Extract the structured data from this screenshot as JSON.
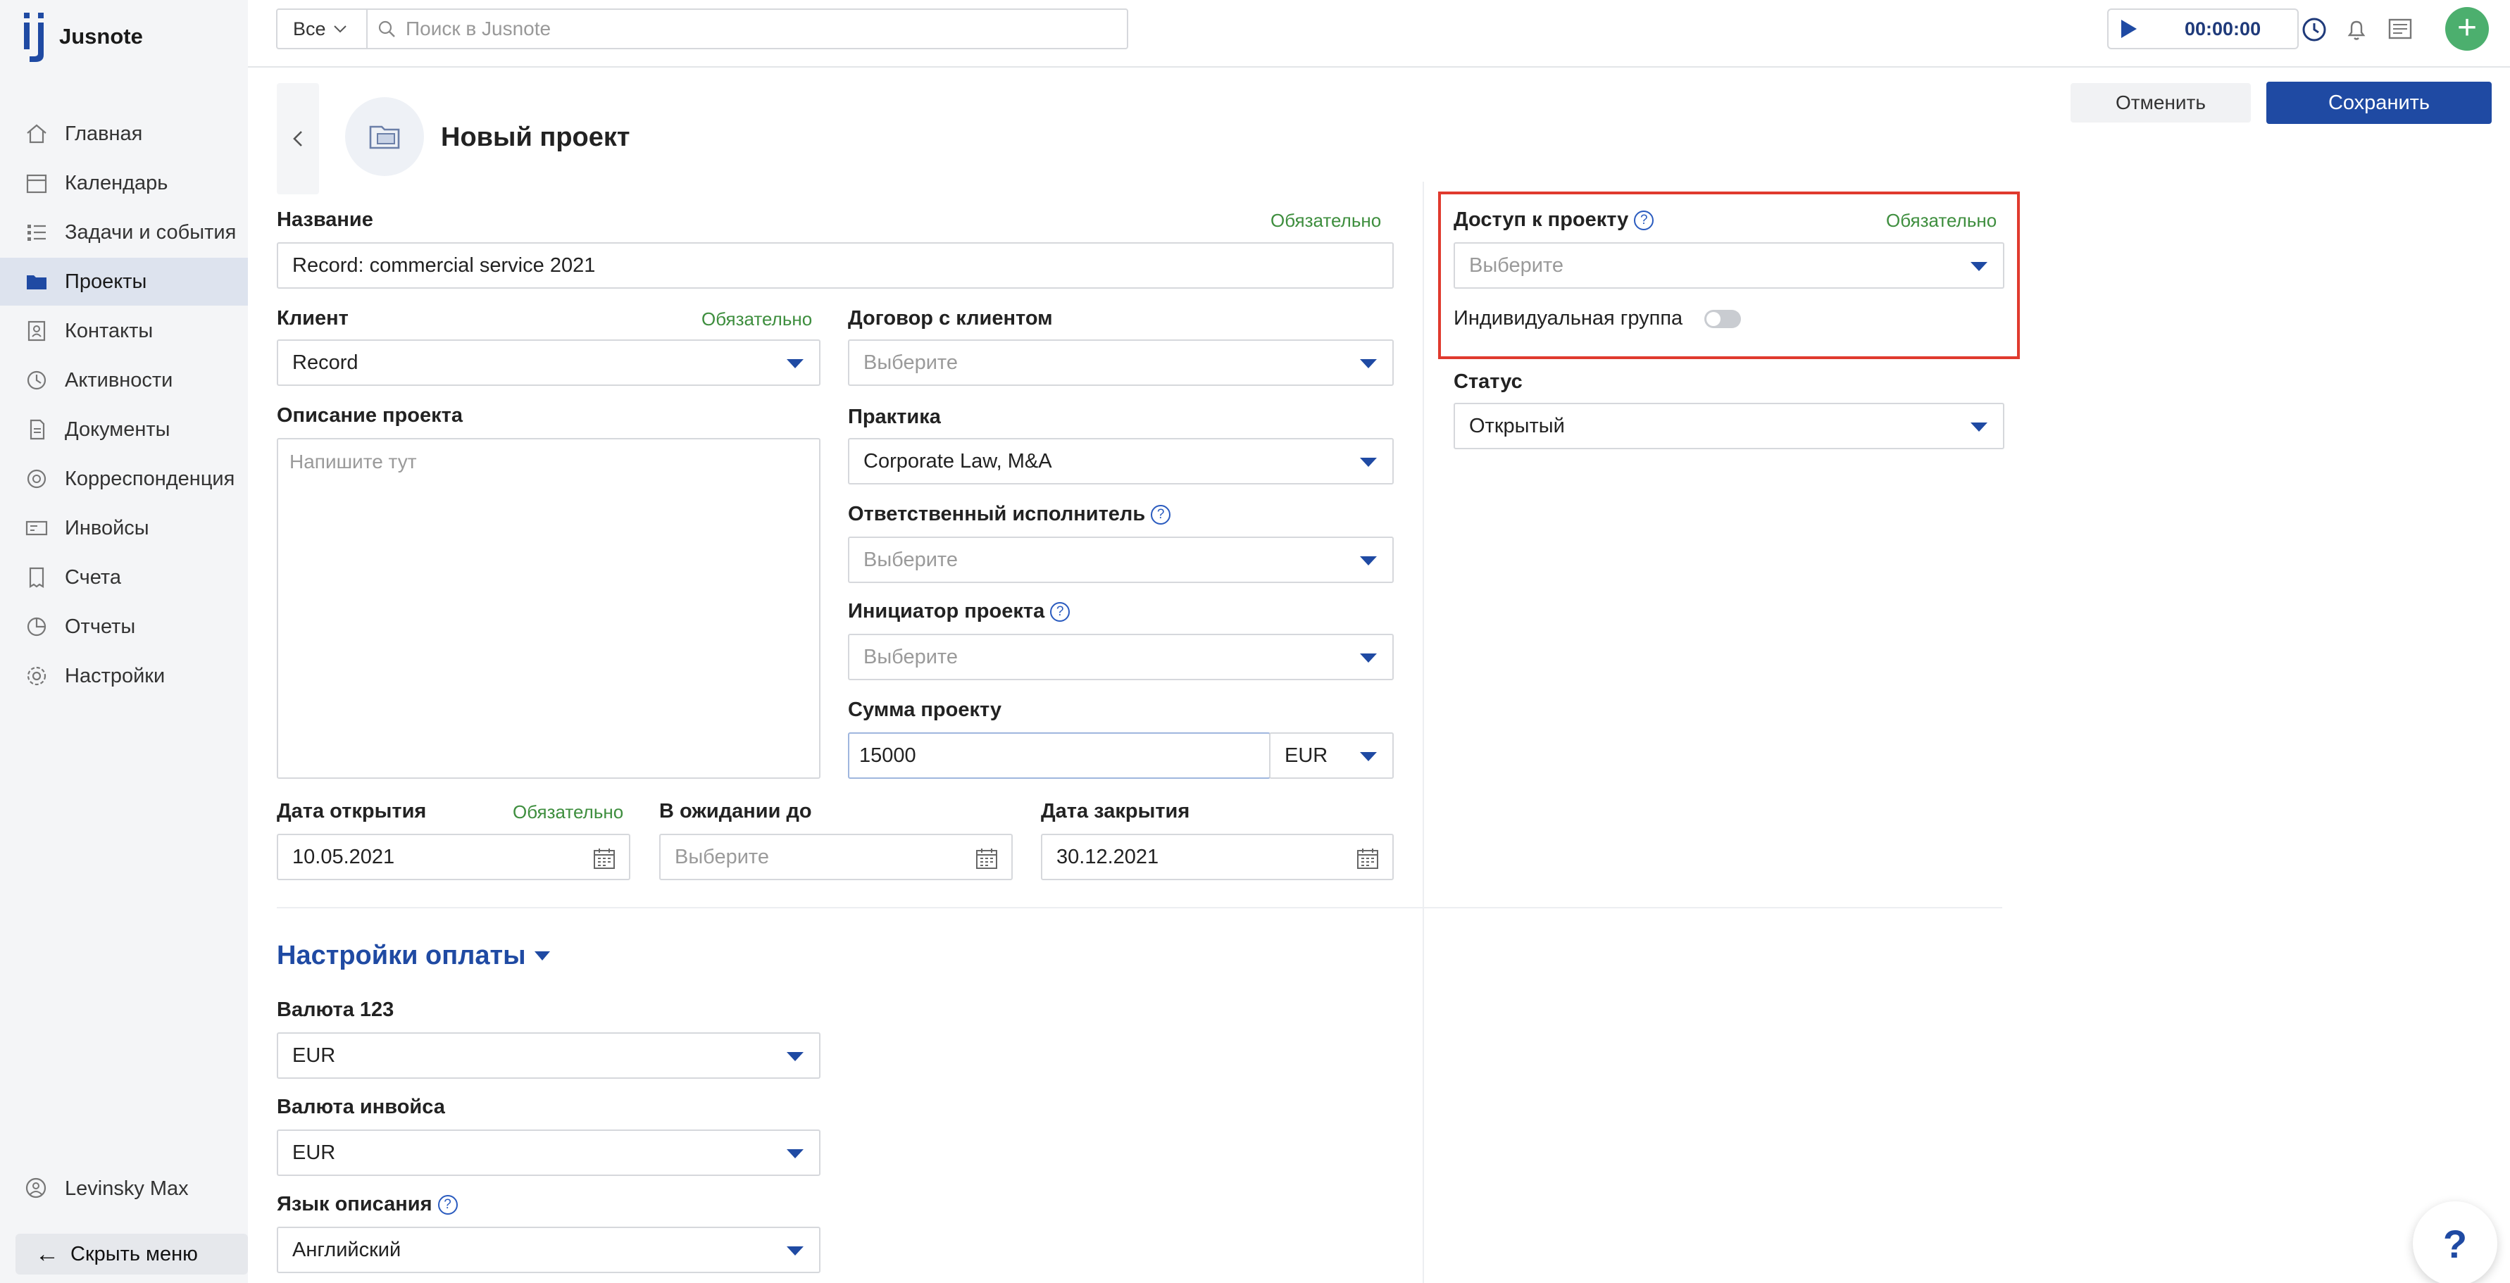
{
  "app": {
    "name": "Jusnote",
    "brand_color": "#1f4aa3"
  },
  "sidebar": {
    "items": [
      {
        "label": "Главная",
        "icon": "home-icon"
      },
      {
        "label": "Календарь",
        "icon": "calendar-icon"
      },
      {
        "label": "Задачи и события",
        "icon": "tasks-icon"
      },
      {
        "label": "Проекты",
        "icon": "folder-icon",
        "active": true
      },
      {
        "label": "Контакты",
        "icon": "contacts-icon"
      },
      {
        "label": "Активности",
        "icon": "activity-icon"
      },
      {
        "label": "Документы",
        "icon": "documents-icon"
      },
      {
        "label": "Корреспонденция",
        "icon": "mail-icon"
      },
      {
        "label": "Инвойсы",
        "icon": "invoice-icon"
      },
      {
        "label": "Счета",
        "icon": "bill-icon"
      },
      {
        "label": "Отчеты",
        "icon": "report-icon"
      },
      {
        "label": "Настройки",
        "icon": "gear-icon"
      }
    ],
    "user": "Levinsky Max",
    "hide_menu": "Скрыть меню"
  },
  "topbar": {
    "search_scope": "Все",
    "search_placeholder": "Поиск в Jusnote",
    "timer": "00:00:00"
  },
  "header": {
    "title": "Новый проект",
    "cancel": "Отменить",
    "save": "Сохранить"
  },
  "required_text": "Обязательно",
  "form": {
    "name_label": "Название",
    "name_value": "Record: commercial service 2021",
    "client_label": "Клиент",
    "client_value": "Record",
    "contract_label": "Договор с клиентом",
    "select_placeholder": "Выберите",
    "description_label": "Описание проекта",
    "description_placeholder": "Напишите тут",
    "practice_label": "Практика",
    "practice_value": "Corporate Law, M&A",
    "responsible_label": "Ответственный исполнитель",
    "initiator_label": "Инициатор проекта",
    "amount_label": "Сумма проекту",
    "amount_value": "15000",
    "amount_currency": "EUR",
    "open_date_label": "Дата открытия",
    "open_date_value": "10.05.2021",
    "pending_label": "В ожидании до",
    "close_date_label": "Дата закрытия",
    "close_date_value": "30.12.2021"
  },
  "right": {
    "access_label": "Доступ к проекту",
    "individual_group_label": "Индивидуальная группа",
    "individual_group_on": false,
    "status_label": "Статус",
    "status_value": "Открытый"
  },
  "payment": {
    "title": "Настройки оплаты",
    "currency_label": "Валюта 123",
    "currency_value": "EUR",
    "invoice_currency_label": "Валюта инвойса",
    "invoice_currency_value": "EUR",
    "lang_label": "Язык описания",
    "lang_value": "Английский"
  },
  "help_fab": "?"
}
